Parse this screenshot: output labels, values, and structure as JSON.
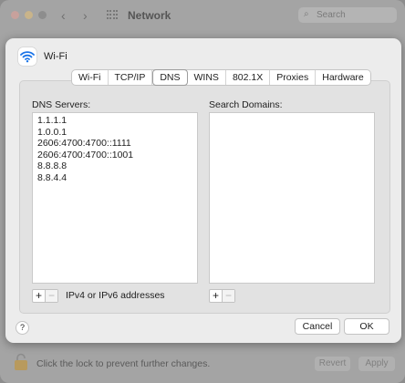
{
  "window": {
    "title": "Network",
    "search_placeholder": "Search",
    "lock_text": "Click the lock to prevent further changes.",
    "revert_label": "Revert",
    "apply_label": "Apply"
  },
  "sheet": {
    "interface_name": "Wi-Fi",
    "tabs": [
      "Wi-Fi",
      "TCP/IP",
      "DNS",
      "WINS",
      "802.1X",
      "Proxies",
      "Hardware"
    ],
    "active_tab": "DNS",
    "dns_label": "DNS Servers:",
    "domains_label": "Search Domains:",
    "dns_servers": [
      "1.1.1.1",
      "1.0.0.1",
      "2606:4700:4700::1111",
      "2606:4700:4700::1001",
      "8.8.8.8",
      "8.8.4.4"
    ],
    "search_domains": [],
    "add_symbol": "+",
    "remove_symbol": "−",
    "hint": "IPv4 or IPv6 addresses",
    "help_symbol": "?",
    "cancel_label": "Cancel",
    "ok_label": "OK"
  },
  "colors": {
    "wifi_accent": "#1a73e8",
    "sheet_background": "#ececec",
    "dimmed_window": "#a4a4a4"
  }
}
